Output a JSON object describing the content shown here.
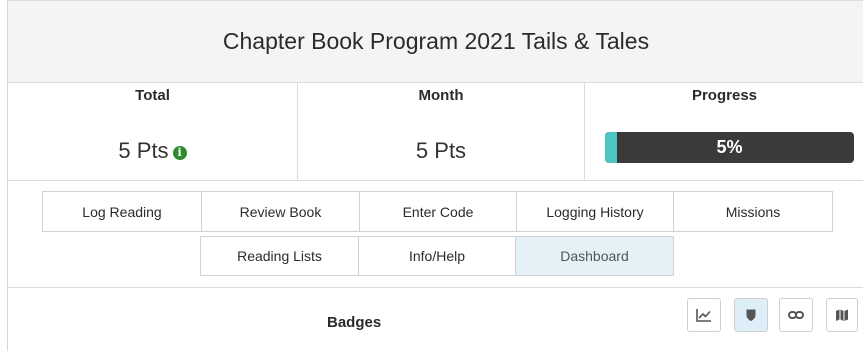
{
  "program": {
    "title": "Chapter Book Program 2021 Tails & Tales"
  },
  "stats": {
    "total": {
      "label": "Total",
      "value": "5 Pts"
    },
    "month": {
      "label": "Month",
      "value": "5 Pts"
    },
    "progress": {
      "label": "Progress",
      "percent": 5,
      "text": "5%"
    }
  },
  "nav": {
    "row1": [
      {
        "label": "Log Reading"
      },
      {
        "label": "Review Book"
      },
      {
        "label": "Enter Code"
      },
      {
        "label": "Logging History"
      },
      {
        "label": "Missions"
      }
    ],
    "row2": [
      {
        "label": "Reading Lists"
      },
      {
        "label": "Info/Help"
      },
      {
        "label": "Dashboard",
        "active": true
      }
    ]
  },
  "badges": {
    "title": "Badges",
    "view_buttons": [
      {
        "icon": "line-chart-icon"
      },
      {
        "icon": "shield-icon",
        "active": true
      },
      {
        "icon": "link-icon"
      },
      {
        "icon": "map-icon"
      }
    ]
  },
  "colors": {
    "progress_fill": "#4cc5c4",
    "progress_track": "#3a3a3a",
    "info_icon": "#2e8b2e",
    "active_tab": "#e4f2f7"
  }
}
